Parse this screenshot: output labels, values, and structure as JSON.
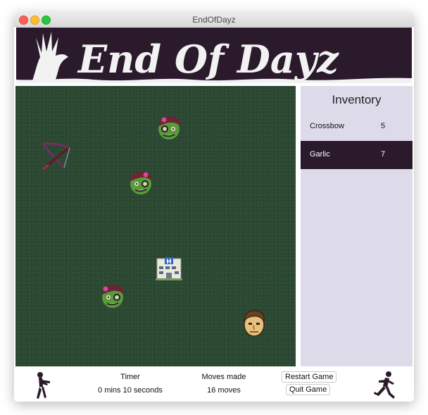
{
  "window": {
    "title": "EndOfDayz"
  },
  "banner": {
    "logo_text": "End Of Dayz"
  },
  "board": {
    "sprites": [
      {
        "name": "zombie-icon",
        "type": "zombie"
      },
      {
        "name": "crossbow-icon",
        "type": "crossbow"
      },
      {
        "name": "zombie-icon",
        "type": "zombie"
      },
      {
        "name": "hospital-icon",
        "type": "hospital"
      },
      {
        "name": "zombie-icon",
        "type": "zombie"
      },
      {
        "name": "player-icon",
        "type": "player"
      }
    ]
  },
  "inventory": {
    "title": "Inventory",
    "items": [
      {
        "name": "Crossbow",
        "count": "5",
        "selected": false
      },
      {
        "name": "Garlic",
        "count": "7",
        "selected": true
      }
    ]
  },
  "footer": {
    "timer_label": "Timer",
    "timer_value": "0 mins 10 seconds",
    "moves_label": "Moves made",
    "moves_value": "16 moves",
    "restart_label": "Restart Game",
    "quit_label": "Quit Game"
  },
  "colors": {
    "banner_bg": "#2a1a2b",
    "board_bg": "#2d4a34",
    "inventory_bg": "#dddbea",
    "selected_row": "#2a1a2b"
  }
}
